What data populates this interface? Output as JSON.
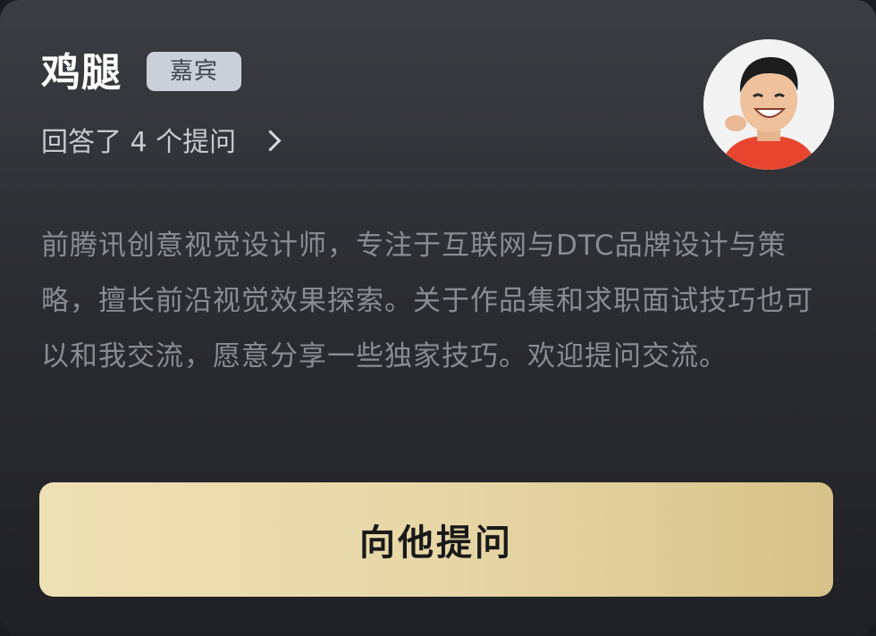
{
  "profile": {
    "name": "鸡腿",
    "badge": "嘉宾",
    "answered_text": "回答了 4 个提问",
    "avatar_icon": "person-avatar-icon",
    "bio": "前腾讯创意视觉设计师，专注于互联网与DTC品牌设计与策略，擅长前沿视觉效果探索。关于作品集和求职面试技巧也可以和我交流，愿意分享一些独家技巧。欢迎提问交流。"
  },
  "action": {
    "ask_label": "向他提问"
  },
  "colors": {
    "card_top": "#3c3d42",
    "card_bottom": "#202124",
    "badge_bg": "#c9d0d8",
    "button_gold": "#e7d7a7"
  }
}
